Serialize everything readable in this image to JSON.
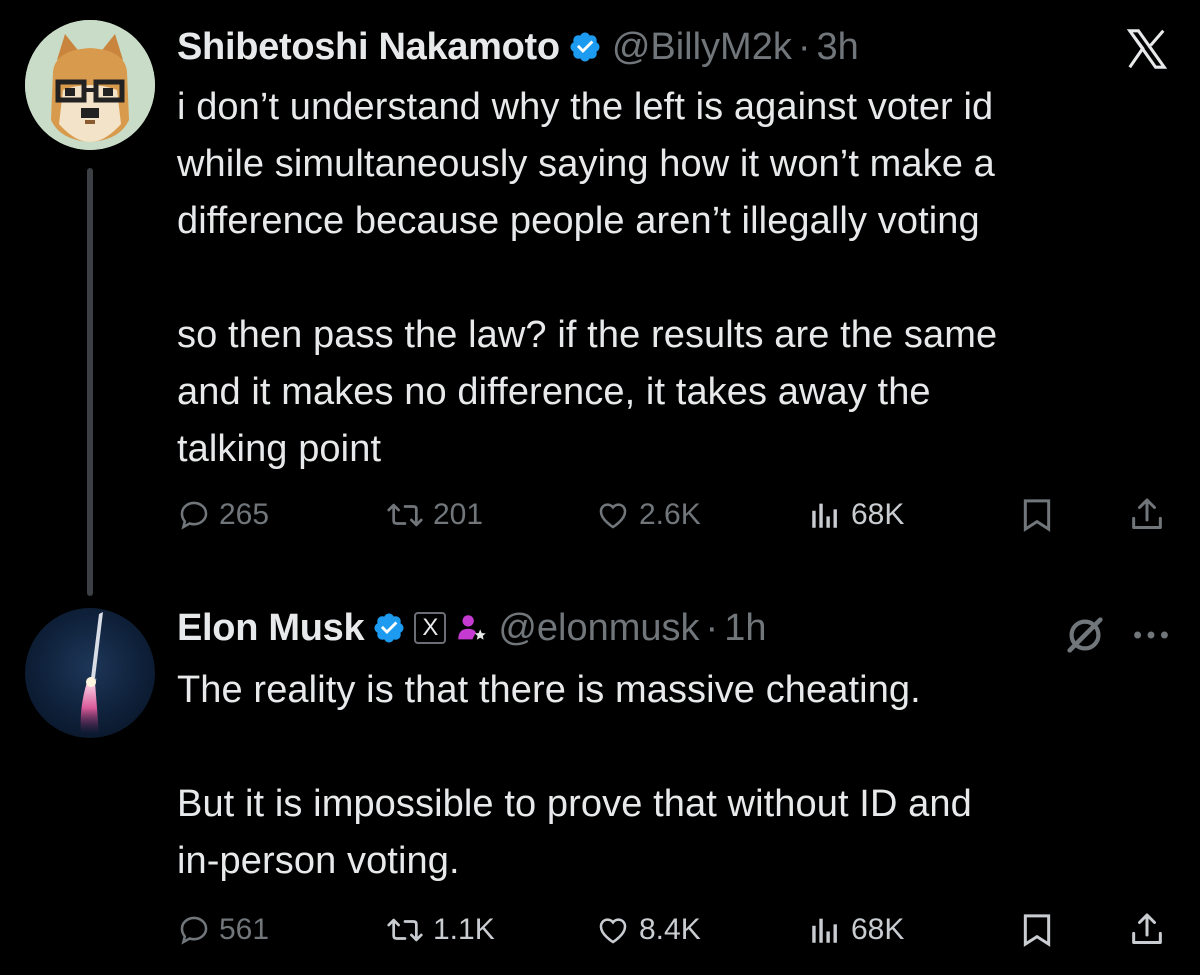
{
  "tweets": [
    {
      "author": {
        "name": "Shibetoshi Nakamoto",
        "handle": "@BillyM2k",
        "verified": true
      },
      "time": "3h",
      "text_lines": [
        "i don’t understand why the left is against voter id",
        "while simultaneously saying how it won’t make a",
        "difference because people aren’t illegally voting",
        "",
        "so then pass the law? if the results are the same",
        "and it makes no difference, it takes away the",
        "talking point"
      ],
      "stats": {
        "replies": "265",
        "reposts": "201",
        "likes": "2.6K",
        "views": "68K"
      }
    },
    {
      "author": {
        "name": "Elon Musk",
        "handle": "@elonmusk",
        "verified": true,
        "affiliate_badge": "X"
      },
      "time": "1h",
      "text_lines": [
        "The reality is that there is massive cheating.",
        "",
        "But it is impossible to prove that without ID and",
        "in-person voting."
      ],
      "stats": {
        "replies": "561",
        "reposts": "1.1K",
        "likes": "8.4K",
        "views": "68K"
      }
    }
  ],
  "colors": {
    "background": "#000000",
    "text": "#e7e9ea",
    "secondary": "#71767b",
    "verified_blue": "#1d9bf0",
    "thread_line": "#3c3f44"
  },
  "icons": [
    "x-logo-icon",
    "verified-icon",
    "reply-icon",
    "repost-icon",
    "like-icon",
    "views-icon",
    "bookmark-icon",
    "share-icon",
    "grok-icon",
    "more-icon",
    "affiliate-icon"
  ]
}
